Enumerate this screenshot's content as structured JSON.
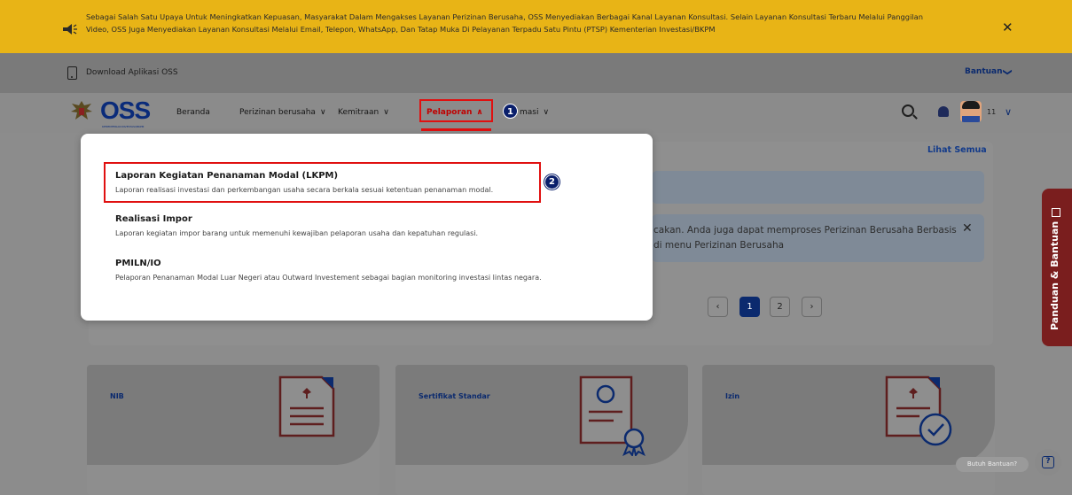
{
  "banner": {
    "text": "Sebagai Salah Satu Upaya Untuk Meningkatkan Kepuasan, Masyarakat Dalam Mengakses Layanan Perizinan Berusaha, OSS Menyediakan Berbagai Kanal Layanan Konsultasi. Selain Layanan Konsultasi Terbaru Melalui Panggilan Video, OSS Juga Menyediakan Layanan Konsultasi Melalui Email, Telepon, WhatsApp, Dan Tatap Muka Di Pelayanan Terpadu Satu Pintu (PTSP) Kementerian Investasi/BKPM",
    "close": "✕",
    "background": "#e8b416"
  },
  "topbar": {
    "download_label": "Download Aplikasi OSS",
    "help_label": "Bantuan",
    "help_chevron": "❯"
  },
  "nav": {
    "logo": "OSS",
    "logo_sub": "KEMENTERIAN INVESTASI/BKPM",
    "items": [
      {
        "label": "Beranda"
      },
      {
        "label": "Perizinan berusaha",
        "chevron": "∨"
      },
      {
        "label": "Kemitraan",
        "chevron": "∨"
      },
      {
        "label": "Pelaporan",
        "chevron": "∧"
      },
      {
        "label": "masi",
        "chevron": "∨"
      }
    ],
    "username": "11",
    "user_chevron": "∨",
    "accent": "#e01010",
    "brand": "#0b2a6e"
  },
  "badges": {
    "one": "1",
    "two": "2"
  },
  "dropdown": {
    "items": [
      {
        "title": "Laporan Kegiatan Penanaman Modal (LKPM)",
        "desc": "Laporan realisasi investasi dan perkembangan usaha secara berkala sesuai ketentuan penanaman modal."
      },
      {
        "title": "Realisasi Impor",
        "desc": "Laporan kegiatan impor barang untuk memenuhi kewajiban pelaporan usaha dan kepatuhan regulasi."
      },
      {
        "title": "PMILN/IO",
        "desc": "Pelaporan Penanaman Modal Luar Negeri atau Outward Investement sebagai bagian monitoring investasi lintas negara."
      }
    ]
  },
  "content": {
    "lihat_semua": "Lihat Semua",
    "info_line1": "cakan. Anda juga dapat memproses Perizinan Berusaha Berbasis",
    "info_line2": "di menu Perizinan Berusaha",
    "info_close": "✕",
    "pagination": {
      "prev": "‹",
      "pages": [
        "1",
        "2"
      ],
      "next": "›",
      "current": "1"
    }
  },
  "cards": [
    {
      "label": "NIB",
      "icon": "document-garuda-icon"
    },
    {
      "label": "Sertifikat Standar",
      "icon": "certificate-icon"
    },
    {
      "label": "Izin",
      "icon": "document-check-icon"
    }
  ],
  "sidetab": {
    "label": "Panduan & Bantuan"
  },
  "help_bubble": "Butuh Bantuan?",
  "help_button": "?"
}
